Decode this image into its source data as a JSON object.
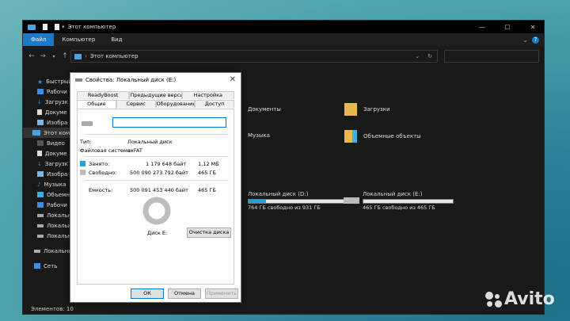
{
  "window": {
    "title": "Этот компьютер",
    "ribbon_tabs": [
      "Файл",
      "Компьютер",
      "Вид"
    ],
    "address": "Этот компьютер",
    "status": "Элементов: 10"
  },
  "sidebar": {
    "items": [
      "Быстрый",
      "Рабочи",
      "Загрузк",
      "Докуме",
      "Изобра",
      "Этот компьютер",
      "Видео",
      "Докуме",
      "Загрузк",
      "Изобра",
      "Музыка",
      "Объемн",
      "Рабочи",
      "Локальн",
      "Локальн",
      "Локальн",
      "Локальный",
      "Сеть"
    ]
  },
  "content": {
    "folders": [
      "Документы",
      "Загрузки",
      "Музыка",
      "Объемные объекты"
    ],
    "drives": [
      {
        "name": "Локальный диск (D:)",
        "free": "764 ГБ свободно из 931 ГБ",
        "used_fraction": 0.18
      },
      {
        "name": "Локальный диск (E:)",
        "free": "465 ГБ свободно из 465 ГБ",
        "used_fraction": 0.0
      }
    ]
  },
  "dialog": {
    "title": "Свойства: Локальный диск (E:)",
    "tabs_top": [
      "ReadyBoost",
      "Предыдущие версии",
      "Настройка"
    ],
    "tabs_bottom": [
      "Общие",
      "Сервис",
      "Оборудование",
      "Доступ"
    ],
    "name_value": "",
    "type_label": "Тип:",
    "type_value": "Локальный диск",
    "fs_label": "Файловая система:",
    "fs_value": "exFAT",
    "used_label": "Занято:",
    "used_bytes": "1 179 648 байт",
    "used_size": "1,12 МБ",
    "free_label": "Свободно:",
    "free_bytes": "500 090 273 792 байт",
    "free_size": "465 ГБ",
    "capacity_label": "Емкость:",
    "capacity_bytes": "500 091 453 440 байт",
    "capacity_size": "465 ГБ",
    "disk_label": "Диск E:",
    "cleanup_button": "Очистка диска",
    "ok_button": "ОК",
    "cancel_button": "Отмена",
    "apply_button": "Применить",
    "colors": {
      "used": "#26a0da",
      "free": "#bdbdbd"
    }
  },
  "watermark": "Avito"
}
